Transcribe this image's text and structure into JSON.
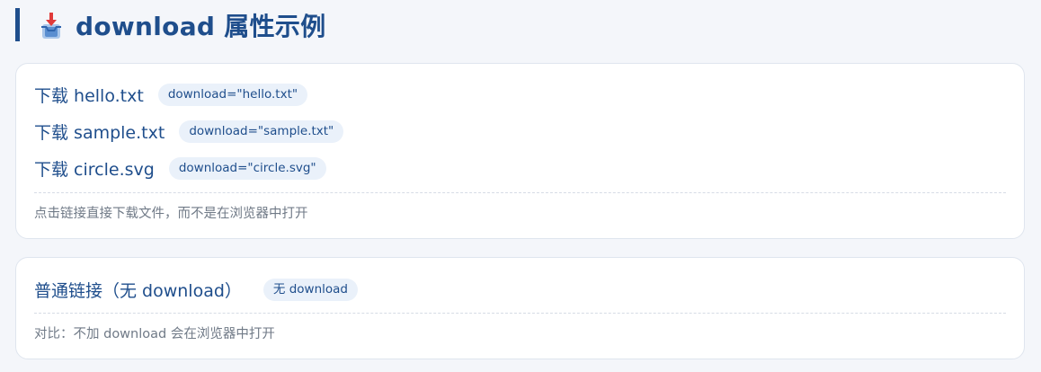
{
  "header": {
    "title": "download 属性示例",
    "icon": "download-tray-icon"
  },
  "download_card": {
    "links": [
      {
        "label": "下载 hello.txt",
        "attribute": "download=\"hello.txt\""
      },
      {
        "label": "下载 sample.txt",
        "attribute": "download=\"sample.txt\""
      },
      {
        "label": "下载 circle.svg",
        "attribute": "download=\"circle.svg\""
      }
    ],
    "note": "点击链接直接下载文件，而不是在浏览器中打开"
  },
  "normal_card": {
    "link_label": "普通链接（无 download）",
    "badge": "无 download",
    "note": "对比：不加 download 会在浏览器中打开"
  },
  "colors": {
    "accent": "#1f4e8c",
    "badge_background": "#eaf1fa",
    "page_background": "#f4f6fa",
    "note_text": "#707a87"
  }
}
